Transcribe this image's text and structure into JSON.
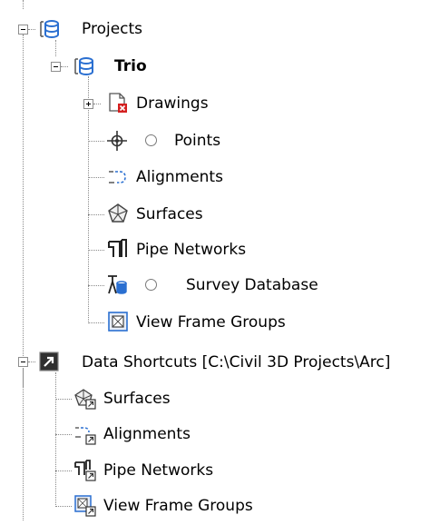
{
  "tree": {
    "projects_label": "Projects",
    "project_name": "Trio",
    "project_items": {
      "drawings": "Drawings",
      "points": "Points",
      "alignments": "Alignments",
      "surfaces": "Surfaces",
      "pipe_networks": "Pipe Networks",
      "survey_database": "Survey Database",
      "view_frame_groups": "View Frame Groups"
    },
    "data_shortcuts_label": "Data Shortcuts [C:\\Civil 3D Projects\\Arc]",
    "shortcut_items": {
      "surfaces": "Surfaces",
      "alignments": "Alignments",
      "pipe_networks": "Pipe Networks",
      "view_frame_groups": "View Frame Groups"
    }
  },
  "colors": {
    "database_blue": "#2a6fd1",
    "drawing_red": "#d42020",
    "shortcut_dark": "#303030",
    "tree_lines": "#8a8a8a"
  }
}
